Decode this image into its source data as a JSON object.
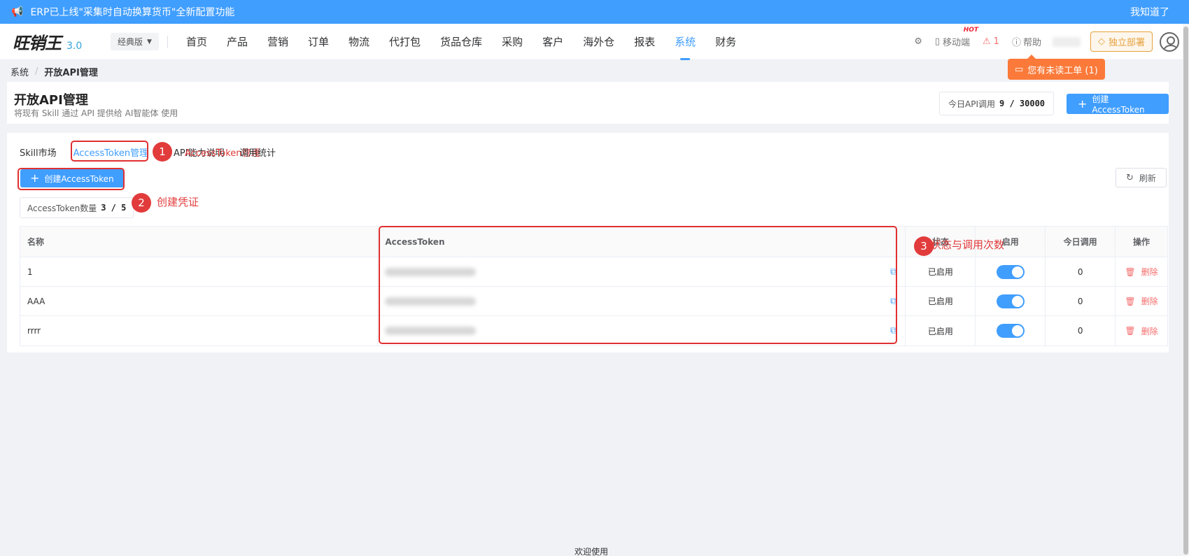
{
  "banner": {
    "text": "ERP已上线\"采集时自动换算货币\"全新配置功能",
    "close": "我知道了"
  },
  "header": {
    "logo_text": "旺销王",
    "logo_version": "3.0",
    "edition": "经典版",
    "nav": [
      "首页",
      "产品",
      "营销",
      "订单",
      "物流",
      "代打包",
      "货品仓库",
      "采购",
      "客户",
      "海外仓",
      "报表",
      "系统",
      "财务"
    ],
    "active_nav": "系统",
    "mobile": "移动端",
    "hot": "HOT",
    "alert_count": "1",
    "help": "帮助",
    "deploy": "独立部署"
  },
  "tooltip": "您有未读工单 (1)",
  "breadcrumb": {
    "root": "系统",
    "sep": "/",
    "current": "开放API管理"
  },
  "page": {
    "title": "开放API管理",
    "subtitle": "将现有 Skill 通过 API 提供给 AI智能体 使用",
    "quota_label": "今日API调用",
    "quota_value": "9 / 30000",
    "create_label": "创建AccessToken"
  },
  "tabs": {
    "skill_market": "Skill市场",
    "token_mgmt": "AccessToken管理",
    "overlap_a": "API能力说明",
    "overlap_b": "AccessToken管理",
    "overlap_c": "调用统计"
  },
  "main": {
    "create_label": "创建AccessToken",
    "refresh_label": "刷新",
    "count_label": "AccessToken数量",
    "count_value": "3 / 5"
  },
  "table": {
    "headers": {
      "name": "名称",
      "token": "AccessToken",
      "status": "状态",
      "enable": "启用",
      "today": "今日调用",
      "op": "操作"
    },
    "rows": [
      {
        "name": "1",
        "status": "已启用",
        "today": "0",
        "op": "删除"
      },
      {
        "name": "AAA",
        "status": "已启用",
        "today": "0",
        "op": "删除"
      },
      {
        "name": "rrrr",
        "status": "已启用",
        "today": "0",
        "op": "删除"
      }
    ]
  },
  "annotations": {
    "m1": "1",
    "t1": "AccessToken管理",
    "m2": "2",
    "t2": "创建凭证",
    "m3": "3",
    "t3": "状态与调用次数"
  },
  "footer": "欢迎使用",
  "colors": {
    "primary": "#409eff",
    "danger": "#f56c6c",
    "annotation": "#e23b3b",
    "tooltip": "#fb7a3a"
  }
}
